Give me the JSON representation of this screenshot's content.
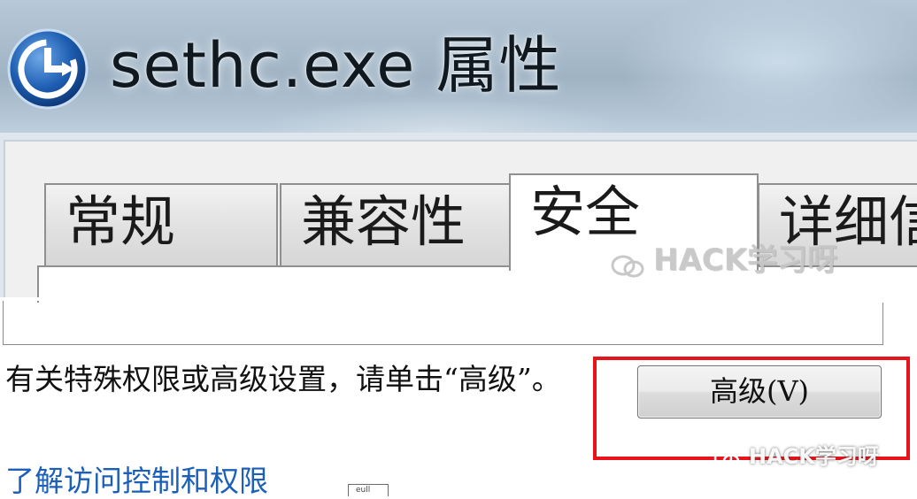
{
  "window": {
    "title": "sethc.exe 属性",
    "icon": "ease-of-access-icon"
  },
  "tabs": [
    {
      "label": "常规",
      "active": false
    },
    {
      "label": "兼容性",
      "active": false
    },
    {
      "label": "安全",
      "active": true
    },
    {
      "label": "详细信",
      "active": false
    }
  ],
  "security": {
    "advanced_hint": "有关特殊权限或高级设置，请单击“高级”。",
    "advanced_button_label": "高级(V)",
    "help_link": "了解访问控制和权限",
    "footer_widget_label": "eull"
  },
  "watermarks": {
    "top": "HACK学习呀",
    "bottom": "HACK学习呀",
    "icon": "wechat-icon"
  },
  "colors": {
    "highlight_border": "#e8141b",
    "link": "#1c5fb8",
    "active_tab_bg": "#ffffff",
    "inactive_tab_bg": "#e2e2e2"
  }
}
